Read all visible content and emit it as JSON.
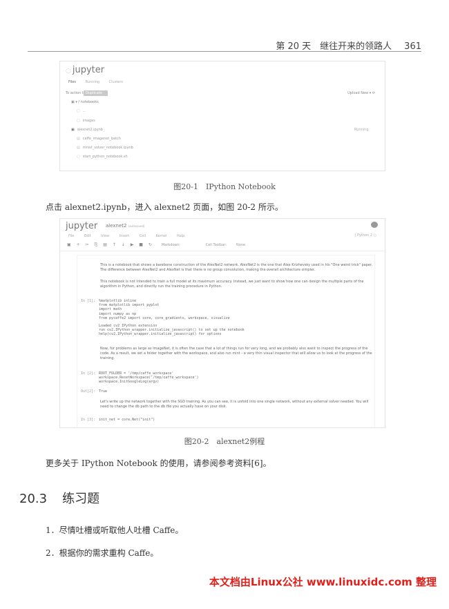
{
  "header": {
    "chapter": "第 20 天　继往开来的领路人",
    "page_number": "361"
  },
  "figure1": {
    "logo": "jupyter",
    "tabs": [
      "Files",
      "Running",
      "Clusters"
    ],
    "toolbar_hint": "To action them",
    "toolbar_button": "Duplicate",
    "toolbar_right": "Upload   New ▾   ⟳",
    "path": "▣  ▾  /  notebooks",
    "rows": [
      {
        "icon": "▢",
        "name": "..",
        "status": ""
      },
      {
        "icon": "▢",
        "name": "images",
        "status": ""
      },
      {
        "icon": "▣",
        "name": "alexnet2.ipynb",
        "status": "Running"
      },
      {
        "icon": "▤",
        "name": "caffe_imagenet_batch",
        "status": ""
      },
      {
        "icon": "▤",
        "name": "mnist_solver_notebook.ipynb",
        "status": ""
      },
      {
        "icon": "▢",
        "name": "start_python_notebook.sh",
        "status": ""
      }
    ],
    "caption": "图20-1　IPython Notebook"
  },
  "para1": "点击 alexnet2.ipynb，进入 alexnet2 页面，如图 20-2 所示。",
  "figure2": {
    "logo": "jupyter",
    "notebook_name": "alexnet2",
    "autosaved": "(autosaved)",
    "menu": [
      "File",
      "Edit",
      "View",
      "Insert",
      "Cell",
      "Kernel",
      "Help"
    ],
    "kernel": "| Python 2 ○",
    "toolbar_icons": [
      "▣",
      "+",
      "✂",
      "⎘",
      "▤",
      "↑",
      "↓",
      "▶",
      "■",
      "↻"
    ],
    "cell_type": "Markdown",
    "celltoolbar_label": "Cell Toolbar:",
    "celltoolbar_value": "None",
    "md1_p1": "This is a notebook that shows a barebone construction of the AlexNet2 network. AlexNet2 is the one that Alex Krizhevsky used in his \"One weird trick\" paper. The difference between AlexNet2 and AlexNet is that there is no group convolution, making the overall architecture simpler.",
    "md1_p2": "This notebook is not intended to train a full model at its maximum accuracy. Instead, we just want to show how one can design the multiple parts of the algorithm in Python, and directly run the training procedure in Python.",
    "prompt1": "In [1]:",
    "code1": "%matplotlib inline\nfrom matplotlib import pyplot\nimport math\nimport numpy as np\nfrom pycaffe2 import core, core_gradients, workspace, visualize",
    "out1": "Loaded cv2 IPython extension\nrun cv2.IPython_wrapper.initialize_javascript() to set up the notebook\nhelp(cv2.IPython_wrapper.initialize_javascript) for options",
    "md2": "Now, for problems as large as ImageNet, it is often the case that a lot of things run for very long, and we probably also want to inspect the progress of the code. As a result, we set a folder together with the workspace, and also run mint - a very thin visual inspector that will allow us to look at the progress of the training.",
    "prompt2": "In [2]:",
    "code2": "ROOT_FOLDER = '/tmp/caffe_workspace'\nworkspace.ResetWorkspace('/tmp/caffe_workspace')\nworkspace.InitGoogleLog(argv)",
    "prompt2_out": "Out[2]:",
    "out2": "True",
    "md3": "Let's write up the network together with the SGD training. As you can see, it is unfold into one single network, without any external solver needed. You will need to change the db path to the db file you actually have on your disk.",
    "prompt3": "In [3]:",
    "code3": "init_net = core.Net(\"init\")",
    "caption": "图20-2　alexnet2例程"
  },
  "para2": "更多关于 IPython Notebook 的使用，请参阅参考资料[6]。",
  "section": {
    "number": "20.3",
    "title": "练习题"
  },
  "exercises": [
    "1．尽情吐槽或听取他人吐槽 Caffe。",
    "2．根据你的需求重构 Caffe。"
  ],
  "watermark": "本文档由Linux公社 www.linuxidc.com 整理"
}
